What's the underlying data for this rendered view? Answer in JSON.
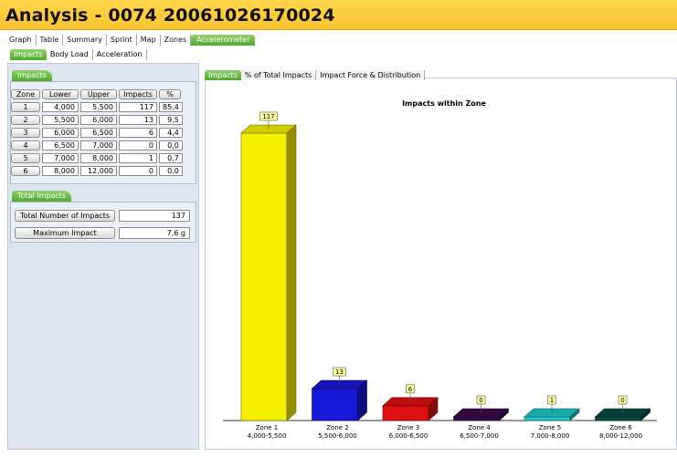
{
  "window": {
    "title": "Analysis - 0074 20061026170024"
  },
  "main_tabs": [
    {
      "label": "Graph",
      "active": false
    },
    {
      "label": "Table",
      "active": false
    },
    {
      "label": "Summary",
      "active": false
    },
    {
      "label": "Sprint",
      "active": false
    },
    {
      "label": "Map",
      "active": false
    },
    {
      "label": "Zones",
      "active": false
    },
    {
      "label": "Accelerometer",
      "active": true
    }
  ],
  "sub_tabs": [
    {
      "label": "Impacts",
      "active": true
    },
    {
      "label": "Body Load",
      "active": false
    },
    {
      "label": "Acceleration",
      "active": false
    }
  ],
  "impacts_group": {
    "tab_label": "Impacts",
    "headers": {
      "zone": "Zone",
      "lower": "Lower",
      "upper": "Upper",
      "impacts": "Impacts",
      "pct": "%"
    },
    "rows": [
      {
        "zone": "1",
        "lower": "4,000",
        "upper": "5,500",
        "impacts": "117",
        "pct": "85,4"
      },
      {
        "zone": "2",
        "lower": "5,500",
        "upper": "6,000",
        "impacts": "13",
        "pct": "9,5"
      },
      {
        "zone": "3",
        "lower": "6,000",
        "upper": "6,500",
        "impacts": "6",
        "pct": "4,4"
      },
      {
        "zone": "4",
        "lower": "6,500",
        "upper": "7,000",
        "impacts": "0",
        "pct": "0,0"
      },
      {
        "zone": "5",
        "lower": "7,000",
        "upper": "8,000",
        "impacts": "1",
        "pct": "0,7"
      },
      {
        "zone": "6",
        "lower": "8,000",
        "upper": "12,000",
        "impacts": "0",
        "pct": "0,0"
      }
    ]
  },
  "total_group": {
    "tab_label": "Total Impacts",
    "total_label": "Total Number of Impacts",
    "total_value": "137",
    "max_label": "Maximum Impact",
    "max_value": "7,6 g"
  },
  "chart_tabs": [
    {
      "label": "Impacts",
      "active": true
    },
    {
      "label": "% of Total Impacts",
      "active": false
    },
    {
      "label": "Impact Force & Distribution",
      "active": false
    }
  ],
  "colors": {
    "title_bar": "#f8c531",
    "tab_active": "#4faa2e"
  },
  "chart_data": {
    "type": "bar",
    "title": "Impacts within Zone",
    "categories": [
      "Zone 1",
      "Zone 2",
      "Zone 3",
      "Zone 4",
      "Zone 5",
      "Zone 6"
    ],
    "category_sublabels": [
      "4,000-5,500",
      "5,500-6,000",
      "6,000-6,500",
      "6,500-7,000",
      "7,000-8,000",
      "8,000-12,000"
    ],
    "values": [
      117,
      13,
      6,
      0,
      1,
      0
    ],
    "colors": [
      "#f5ef00",
      "#1818d8",
      "#e01010",
      "#3a0a4a",
      "#20c8c8",
      "#064a44"
    ],
    "xlabel": "",
    "ylabel": "",
    "ylim": [
      0,
      117
    ],
    "style": "3d-bar",
    "grid": false
  }
}
